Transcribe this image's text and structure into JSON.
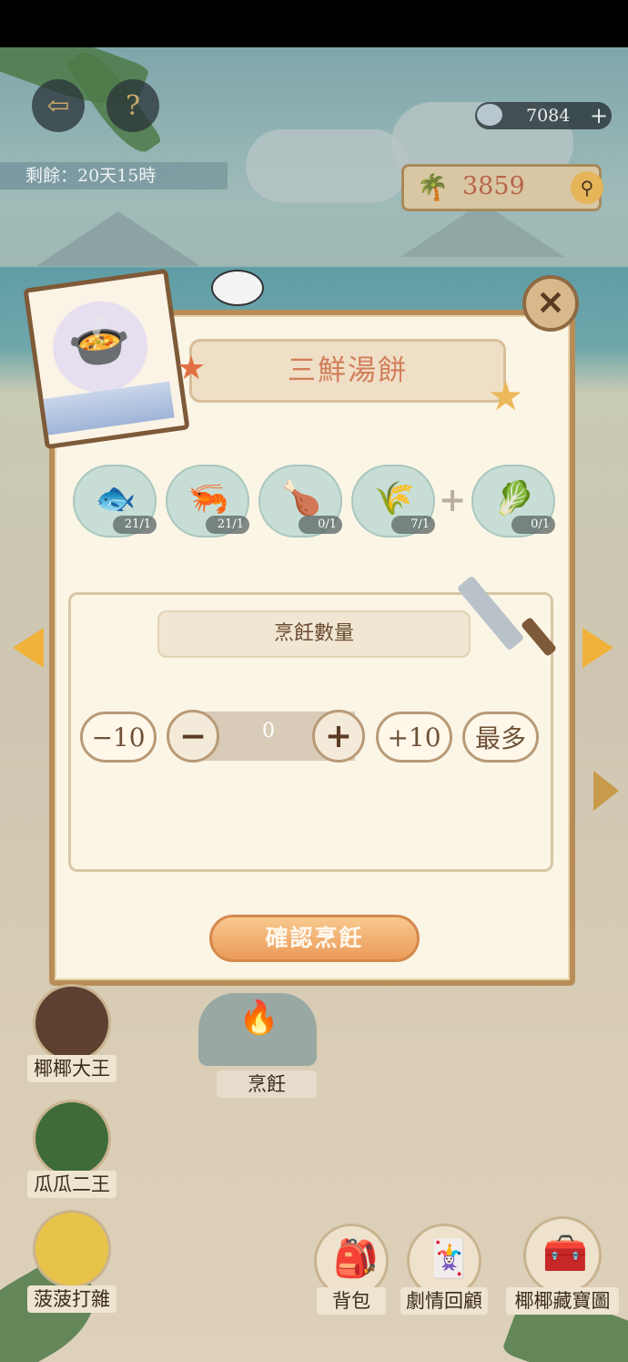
{
  "header": {
    "remaining_label": "剩餘：20天15時",
    "shells": "7084",
    "shells_add": "+",
    "palm_count": "3859",
    "back_icon": "back-arrow-icon",
    "help_icon": "?"
  },
  "recipe": {
    "title": "三鮮湯餅",
    "ingredients": [
      {
        "name": "fish",
        "icon": "🐟",
        "count": "21/1"
      },
      {
        "name": "shrimp",
        "icon": "🦐",
        "count": "21/1"
      },
      {
        "name": "chicken",
        "icon": "🍗",
        "count": "0/1"
      },
      {
        "name": "wheat",
        "icon": "🌾",
        "count": "7/1"
      },
      {
        "name": "scallion",
        "icon": "🥬",
        "count": "0/1"
      }
    ],
    "plus": "+"
  },
  "cooking": {
    "quantity_label": "烹飪數量",
    "minus10": "−10",
    "minus": "−",
    "value": "0",
    "plus": "+",
    "plus10": "+10",
    "max": "最多",
    "confirm": "確認烹飪",
    "close": "✕"
  },
  "characters": [
    {
      "name": "椰椰大王"
    },
    {
      "name": "瓜瓜二王"
    },
    {
      "name": "菠菠打雜"
    }
  ],
  "station": {
    "label": "烹飪"
  },
  "bottom_nav": [
    {
      "label": "背包"
    },
    {
      "label": "劇情回顧"
    },
    {
      "label": "椰椰藏寶圖"
    }
  ],
  "colors": {
    "accent": "#eb9b5a",
    "panel_border": "#b88d57",
    "title_text": "#d27e5a"
  }
}
